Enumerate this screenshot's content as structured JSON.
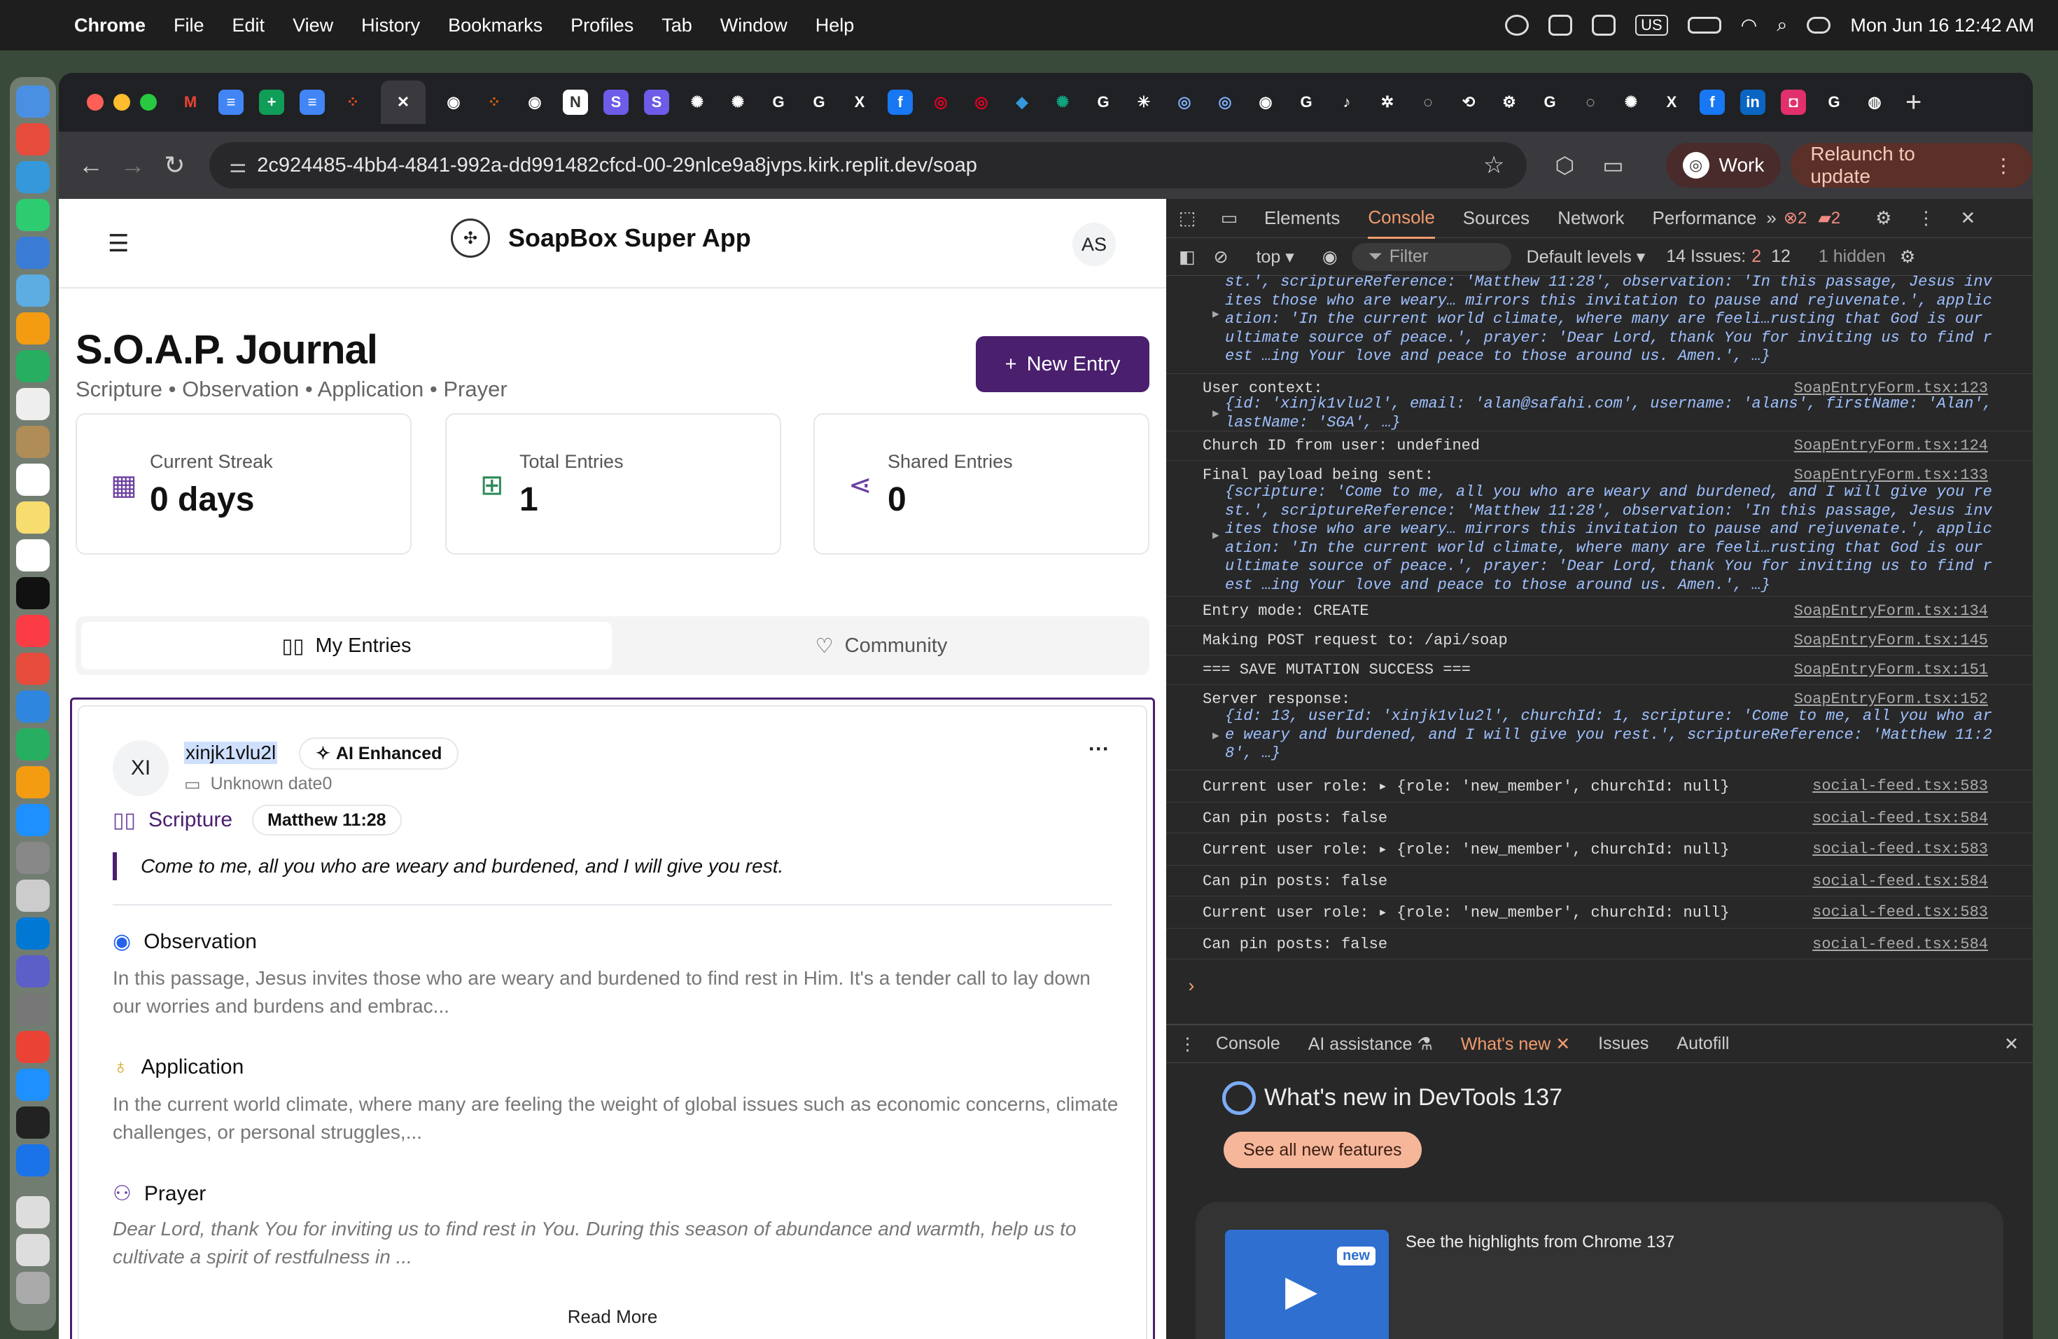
{
  "menubar": {
    "app": "Chrome",
    "items": [
      "File",
      "Edit",
      "View",
      "History",
      "Bookmarks",
      "Profiles",
      "Tab",
      "Window",
      "Help"
    ],
    "input_badge": "US",
    "clock": "Mon Jun 16  12:42 AM"
  },
  "browser": {
    "url": "2c924485-4bb4-4841-992a-dd991482cfcd-00-29nlce9a8jvps.kirk.replit.dev/soap",
    "profile": "Work",
    "relaunch": "Relaunch to update"
  },
  "app": {
    "name": "SoapBox Super App",
    "logo_text": "SOAPBOX",
    "user_initials": "AS",
    "title": "S.O.A.P. Journal",
    "subtitle": "Scripture • Observation • Application • Prayer",
    "new_entry": "New Entry",
    "stats": [
      {
        "label": "Current Streak",
        "value": "0 days",
        "icon": "calendar-icon"
      },
      {
        "label": "Total Entries",
        "value": "1",
        "icon": "book-icon"
      },
      {
        "label": "Shared Entries",
        "value": "0",
        "icon": "share-icon"
      }
    ],
    "tabs": {
      "my_entries": "My Entries",
      "community": "Community"
    },
    "entry": {
      "initials": "XI",
      "username": "xinjk1vlu2l",
      "badge": "AI Enhanced",
      "date": "Unknown date0",
      "scripture_label": "Scripture",
      "reference": "Matthew 11:28",
      "scripture": "Come to me, all you who are weary and burdened, and I will give you rest.",
      "observation_label": "Observation",
      "observation": "In this passage, Jesus invites those who are weary and burdened to find rest in Him. It's a tender call to lay down our worries and burdens and embrac...",
      "application_label": "Application",
      "application": "In the current world climate, where many are feeling the weight of global issues such as economic concerns, climate challenges, or personal struggles,...",
      "prayer_label": "Prayer",
      "prayer": "Dear Lord, thank You for inviting us to find rest in You. During this season of abundance and warmth, help us to cultivate a spirit of restfulness in ...",
      "read_more": "Read More"
    }
  },
  "devtools": {
    "tabs": [
      "Elements",
      "Console",
      "Sources",
      "Network",
      "Performance"
    ],
    "active_tab": "Console",
    "errors": "2",
    "warnings": "2",
    "context": "top",
    "filter": "Filter",
    "levels": "Default levels",
    "issues_label": "14 Issues:",
    "issues_err": "2",
    "issues_info": "12",
    "hidden": "1 hidden",
    "logs": [
      {
        "msg": "",
        "src": "",
        "obj": [
          "st.', scriptureReference: 'Matthew 11:28', observation: 'In this passage, Jesus inv",
          "ites those who are weary… mirrors this invitation to pause and rejuvenate.', applic",
          "ation: 'In the current world climate, where many are feeli…rusting that God is our",
          "ultimate source of peace.', prayer: 'Dear Lord, thank You for inviting us to find r",
          "est …ing Your love and peace to those around us. Amen.', …}"
        ]
      },
      {
        "msg": "User context:",
        "src": "SoapEntryForm.tsx:123",
        "obj": [
          "{id: 'xinjk1vlu2l', email: 'alan@safahi.com', username: 'alans', firstName: 'Alan',",
          "lastName: 'SGA', …}"
        ]
      },
      {
        "msg": "Church ID from user: undefined",
        "src": "SoapEntryForm.tsx:124",
        "obj": []
      },
      {
        "msg": "Final payload being sent:",
        "src": "SoapEntryForm.tsx:133",
        "obj": [
          "{scripture: 'Come to me, all you who are weary and burdened, and I will give you re",
          "st.', scriptureReference: 'Matthew 11:28', observation: 'In this passage, Jesus inv",
          "ites those who are weary… mirrors this invitation to pause and rejuvenate.', applic",
          "ation: 'In the current world climate, where many are feeli…rusting that God is our",
          "ultimate source of peace.', prayer: 'Dear Lord, thank You for inviting us to find r",
          "est …ing Your love and peace to those around us. Amen.', …}"
        ]
      },
      {
        "msg": "Entry mode: CREATE",
        "src": "SoapEntryForm.tsx:134",
        "obj": []
      },
      {
        "msg": "Making POST request to: /api/soap",
        "src": "SoapEntryForm.tsx:145",
        "obj": []
      },
      {
        "msg": "=== SAVE MUTATION SUCCESS ===",
        "src": "SoapEntryForm.tsx:151",
        "obj": []
      },
      {
        "msg": "Server response:",
        "src": "SoapEntryForm.tsx:152",
        "obj": [
          "{id: 13, userId: 'xinjk1vlu2l', churchId: 1, scripture: 'Come to me, all you who ar",
          "e weary and burdened, and I will give you rest.', scriptureReference: 'Matthew 11:2",
          "8', …}"
        ]
      },
      {
        "msg": "Current user role:  ▸ {role: 'new_member', churchId: null}",
        "src": "social-feed.tsx:583",
        "obj": []
      },
      {
        "msg": "Can pin posts: false",
        "src": "social-feed.tsx:584",
        "obj": []
      },
      {
        "msg": "Current user role:  ▸ {role: 'new_member', churchId: null}",
        "src": "social-feed.tsx:583",
        "obj": []
      },
      {
        "msg": "Can pin posts: false",
        "src": "social-feed.tsx:584",
        "obj": []
      },
      {
        "msg": "Current user role:  ▸ {role: 'new_member', churchId: null}",
        "src": "social-feed.tsx:583",
        "obj": []
      },
      {
        "msg": "Can pin posts: false",
        "src": "social-feed.tsx:584",
        "obj": []
      }
    ],
    "drawer_tabs": [
      "Console",
      "AI assistance",
      "What's new",
      "Issues",
      "Autofill"
    ],
    "whats_new_title": "What's new in DevTools 137",
    "see_all": "See all new features",
    "highlight": "See the highlights from Chrome 137",
    "new_badge": "new"
  }
}
